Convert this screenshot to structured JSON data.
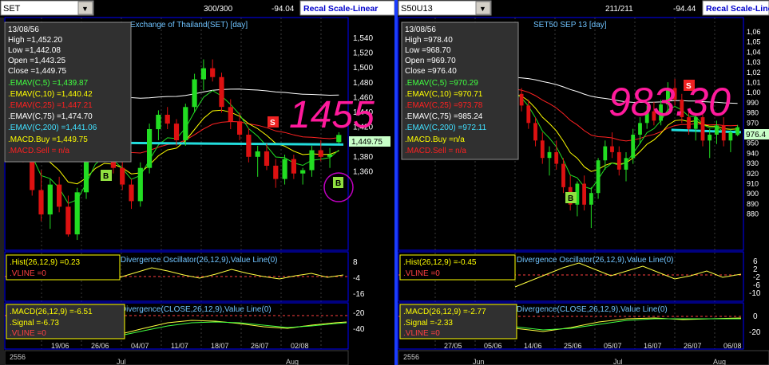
{
  "panels": [
    {
      "symbol": "SET",
      "counter": "300/300",
      "change": "-94.04",
      "recal_label": "Recal Scale-Linear",
      "chart_title": "Exchange of Thailand(SET) [day]",
      "big_value": "1455",
      "last_price_tag": "1,449.75",
      "info_box": {
        "date": "13/08/56",
        "high": "High =1,452.20",
        "low": "Low =1,442.08",
        "open": "Open =1,443.25",
        "close": "Close =1,449.75",
        "emav5": ".EMAV(C,5) =1,439.87",
        "emav10": ".EMAV(C,10) =1,440.42",
        "emav25": ".EMAV(C,25) =1,447.21",
        "emav75": ".EMAV(C,75) =1,474.70",
        "emav200": ".EMAV(C,200) =1,441.06",
        "macd_buy": ".MACD.Buy =1,449.75",
        "macd_sell": ".MACD.Sell = n/a"
      },
      "hist_panel": {
        "title": "Divergence / Divergence Oscillator(26,12,9),Value Line(0)",
        "hist_label": ".Hist(26,12,9) =0.23",
        "vline_label": ".VLINE =0"
      },
      "macd_panel": {
        "title": "Divergence / Divergence(CLOSE,26,12,9),Value Line(0)",
        "macd_label": ".MACD(26,12,9) =-6.51",
        "signal_label": ".Signal =-6.73",
        "vline_label": ".VLINE =0"
      },
      "year_label": "2556",
      "month_labels": [
        "Jul",
        "Aug"
      ],
      "date_labels": [
        "19/06",
        "26/06",
        "04/07",
        "11/07",
        "18/07",
        "26/07",
        "02/08"
      ],
      "price_ticks": [
        "1,540",
        "1,520",
        "1,500",
        "1,480",
        "1,460",
        "1,440",
        "1,420",
        "1,400",
        "1,380",
        "1,360"
      ],
      "hist_ticks": [
        "8",
        "-4",
        "-16"
      ],
      "macd_ticks": [
        "-20",
        "-40"
      ],
      "markers": [
        "B",
        "S",
        "B"
      ]
    },
    {
      "symbol": "S50U13",
      "counter": "211/211",
      "change": "-94.44",
      "recal_label": "Recal Scale-Linear",
      "chart_title": "SET50 SEP 13 [day]",
      "big_value": "983.30",
      "last_price_tag": "976.4",
      "info_box": {
        "date": "13/08/56",
        "high": "High =978.40",
        "low": "Low =968.70",
        "open": "Open =969.70",
        "close": "Close =976.40",
        "emav5": ".EMAV(C,5) =970.29",
        "emav10": ".EMAV(C,10) =970.71",
        "emav25": ".EMAV(C,25) =973.78",
        "emav75": ".EMAV(C,75) =985.24",
        "emav200": ".EMAV(C,200) =972.11",
        "macd_buy": ".MACD.Buy =n/a",
        "macd_sell": ".MACD.Sell = n/a"
      },
      "hist_panel": {
        "title": "Divergence / Divergence Oscillator(26,12,9),Value Line(0)",
        "hist_label": ".Hist(26,12,9) =-0.45",
        "vline_label": ".VLINE =0"
      },
      "macd_panel": {
        "title": "Divergence / Divergence(CLOSE,26,12,9),Value Line(0)",
        "macd_label": ".MACD(26,12,9) =-2.77",
        "signal_label": ".Signal =-2.33",
        "vline_label": ".VLINE =0"
      },
      "year_label": "2556",
      "month_labels": [
        "Jun",
        "Jul",
        "Aug"
      ],
      "date_labels": [
        "27/05",
        "05/06",
        "14/06",
        "25/06",
        "05/07",
        "16/07",
        "26/07",
        "06/08"
      ],
      "price_ticks": [
        "1,06",
        "1,05",
        "1,04",
        "1,03",
        "1,02",
        "1,01",
        "1,00",
        "990",
        "980",
        "970",
        "960",
        "950",
        "940",
        "930",
        "920",
        "910",
        "900",
        "890",
        "880"
      ],
      "hist_ticks": [
        "6",
        "2",
        "-2",
        "-6",
        "-10"
      ],
      "macd_ticks": [
        "0",
        "-20"
      ],
      "markers": [
        "S",
        "B"
      ]
    }
  ],
  "colors": {
    "up": "#22dd22",
    "down": "#dd1111",
    "ema200": "#22dddd",
    "ema75": "#ffffff",
    "ema25": "#ff2222",
    "ema10": "#ffff00",
    "big_value": "#ff1a9c",
    "recal_text": "#0000cc",
    "frame": "#0000ff"
  },
  "chart_data": [
    {
      "type": "candlestick",
      "title": "Exchange of Thailand(SET) [day]",
      "ylim": [
        1350,
        1550
      ],
      "x_labels": [
        "19/06",
        "26/06",
        "04/07",
        "11/07",
        "18/07",
        "26/07",
        "02/08"
      ],
      "last": {
        "date": "13/08/56",
        "open": 1443.25,
        "high": 1452.2,
        "low": 1442.08,
        "close": 1449.75
      },
      "emav": {
        "5": 1439.87,
        "10": 1440.42,
        "25": 1447.21,
        "75": 1474.7,
        "200": 1441.06
      },
      "ohlc": [
        [
          1470,
          1478,
          1452,
          1455
        ],
        [
          1455,
          1458,
          1425,
          1428
        ],
        [
          1428,
          1435,
          1395,
          1400
        ],
        [
          1400,
          1418,
          1372,
          1378
        ],
        [
          1378,
          1410,
          1365,
          1405
        ],
        [
          1405,
          1412,
          1380,
          1385
        ],
        [
          1385,
          1395,
          1358,
          1360
        ],
        [
          1360,
          1402,
          1355,
          1398
        ],
        [
          1398,
          1440,
          1392,
          1435
        ],
        [
          1435,
          1462,
          1428,
          1458
        ],
        [
          1458,
          1468,
          1440,
          1445
        ],
        [
          1445,
          1450,
          1415,
          1420
        ],
        [
          1420,
          1426,
          1400,
          1405
        ],
        [
          1405,
          1410,
          1383,
          1390
        ],
        [
          1390,
          1425,
          1385,
          1420
        ],
        [
          1420,
          1460,
          1415,
          1455
        ],
        [
          1455,
          1472,
          1445,
          1468
        ],
        [
          1468,
          1475,
          1455,
          1460
        ],
        [
          1460,
          1464,
          1440,
          1445
        ],
        [
          1445,
          1478,
          1440,
          1475
        ],
        [
          1475,
          1505,
          1470,
          1500
        ],
        [
          1500,
          1518,
          1490,
          1510
        ],
        [
          1510,
          1518,
          1498,
          1502
        ],
        [
          1502,
          1506,
          1470,
          1475
        ],
        [
          1475,
          1482,
          1455,
          1462
        ],
        [
          1462,
          1470,
          1445,
          1450
        ],
        [
          1450,
          1456,
          1425,
          1430
        ],
        [
          1430,
          1440,
          1412,
          1435
        ],
        [
          1435,
          1442,
          1418,
          1422
        ],
        [
          1422,
          1428,
          1402,
          1410
        ],
        [
          1410,
          1432,
          1405,
          1428
        ],
        [
          1428,
          1432,
          1410,
          1415
        ],
        [
          1415,
          1420,
          1405,
          1418
        ],
        [
          1418,
          1440,
          1412,
          1436
        ],
        [
          1436,
          1445,
          1426,
          1430
        ],
        [
          1430,
          1438,
          1420,
          1432
        ],
        [
          1443.25,
          1452.2,
          1442.08,
          1449.75
        ]
      ]
    },
    {
      "type": "candlestick",
      "title": "SET50 SEP 13 [day]",
      "ylim": [
        875,
        1065
      ],
      "x_labels": [
        "27/05",
        "05/06",
        "14/06",
        "25/06",
        "05/07",
        "16/07",
        "26/07",
        "06/08"
      ],
      "last": {
        "date": "13/08/56",
        "open": 969.7,
        "high": 978.4,
        "low": 968.7,
        "close": 976.4
      },
      "emav": {
        "5": 970.29,
        "10": 970.71,
        "25": 973.78,
        "75": 985.24,
        "200": 972.11
      },
      "ohlc": [
        [
          1015,
          1020,
          1000,
          1005
        ],
        [
          1005,
          1010,
          990,
          995
        ],
        [
          995,
          1000,
          975,
          980
        ],
        [
          980,
          985,
          960,
          965
        ],
        [
          965,
          972,
          945,
          950
        ],
        [
          950,
          960,
          935,
          955
        ],
        [
          955,
          965,
          940,
          945
        ],
        [
          945,
          950,
          920,
          925
        ],
        [
          925,
          935,
          905,
          910
        ],
        [
          910,
          930,
          900,
          928
        ],
        [
          928,
          935,
          905,
          910
        ],
        [
          910,
          925,
          890,
          920
        ],
        [
          920,
          950,
          915,
          948
        ],
        [
          948,
          965,
          940,
          960
        ],
        [
          960,
          972,
          950,
          955
        ],
        [
          955,
          960,
          935,
          940
        ],
        [
          940,
          955,
          930,
          950
        ],
        [
          950,
          975,
          945,
          970
        ],
        [
          970,
          985,
          962,
          980
        ],
        [
          980,
          995,
          975,
          990
        ],
        [
          990,
          998,
          978,
          982
        ],
        [
          982,
          1000,
          978,
          996
        ],
        [
          996,
          1015,
          990,
          1010
        ],
        [
          1010,
          1018,
          995,
          1000
        ],
        [
          1000,
          1005,
          980,
          985
        ],
        [
          985,
          992,
          970,
          975
        ],
        [
          975,
          988,
          965,
          985
        ],
        [
          985,
          990,
          960,
          965
        ],
        [
          965,
          975,
          950,
          970
        ],
        [
          970,
          982,
          962,
          978
        ],
        [
          978,
          985,
          960,
          965
        ],
        [
          965,
          975,
          955,
          972
        ],
        [
          969.7,
          978.4,
          968.7,
          976.4
        ]
      ]
    }
  ]
}
